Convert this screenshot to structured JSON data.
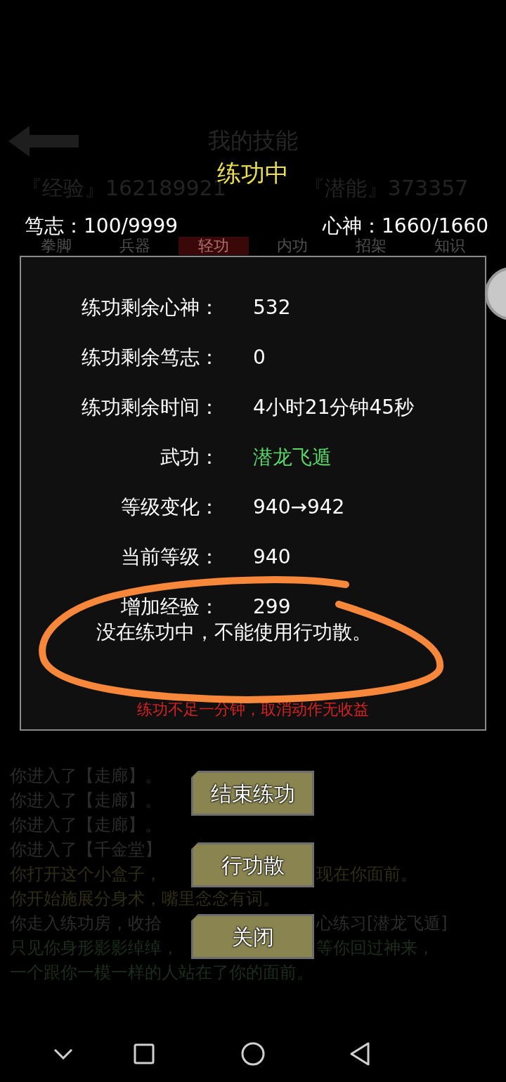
{
  "background": {
    "title": "我的技能",
    "stats": [
      {
        "label": "『经验』",
        "value": "162189921"
      },
      {
        "label": "『潜能』",
        "value": "373357"
      }
    ],
    "tabs": [
      {
        "label": "拳脚",
        "selected": false
      },
      {
        "label": "兵器",
        "selected": false
      },
      {
        "label": "轻功",
        "selected": true
      },
      {
        "label": "内功",
        "selected": false
      },
      {
        "label": "招架",
        "selected": false
      },
      {
        "label": "知识",
        "selected": false
      }
    ],
    "log": [
      {
        "left": "你进入了【走廊】。",
        "color": "#2c2c2c"
      },
      {
        "left": "你进入了【走廊】。",
        "color": "#2c2c2c"
      },
      {
        "left": "你进入了【走廊】。",
        "color": "#2c2c2c"
      },
      {
        "left": "你进入了【千金堂】",
        "color": "#2c2c2c"
      },
      {
        "left": "你打开这个小盒子，",
        "right": "现在你面前。",
        "color": "#302e14"
      },
      {
        "left": "你开始施展分身术，嘴里念念有词。",
        "color": "#302e14"
      },
      {
        "left": "你走入练功房，收拾",
        "right": "心练习[潜龙飞遁]",
        "color": "#2c2c2c"
      },
      {
        "left": "只见你身形影影绰绰，",
        "right": "等你回过神来，",
        "color": "#1e2e1e"
      },
      {
        "left": "一个跟你一模一样的人站在了你的面前。",
        "color": "#1e2e1e"
      }
    ]
  },
  "dialog": {
    "title": "练功中",
    "stats": [
      {
        "label": "笃志：",
        "value": "100/9999"
      },
      {
        "label": "心神：",
        "value": "1660/1660"
      }
    ],
    "rows": [
      {
        "label": "练功剩余心神：",
        "value": "532",
        "kind": "plain"
      },
      {
        "label": "练功剩余笃志：",
        "value": "0",
        "kind": "plain"
      },
      {
        "label": "练功剩余时间：",
        "value": "4小时21分钟45秒",
        "kind": "plain"
      },
      {
        "label": "武功：",
        "value": "潜龙飞遁",
        "kind": "skill"
      },
      {
        "label": "等级变化：",
        "value": "940→942",
        "kind": "plain"
      },
      {
        "label": "当前等级：",
        "value": "940",
        "kind": "plain"
      },
      {
        "label": "增加经验：",
        "value": "299",
        "kind": "plain"
      }
    ],
    "message": "没在练功中，不能使用行功散。",
    "warning": "练功不足一分钟，取消动作无收益",
    "buttons": [
      "结束练功",
      "行功散",
      "关闭"
    ]
  }
}
